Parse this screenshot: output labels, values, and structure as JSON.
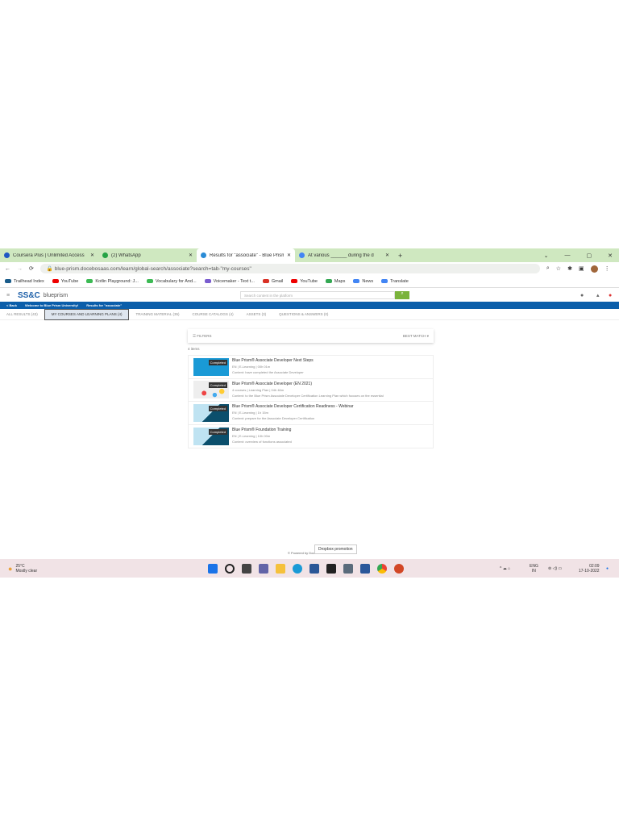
{
  "browser": {
    "tabs": [
      {
        "label": "Coursera Plus | Unlimited Access",
        "color": "#1f57c3"
      },
      {
        "label": "(2) WhatsApp",
        "color": "#25a244"
      },
      {
        "label": "Results for \"associate\" - Blue Prism",
        "color": "#2a8bd6",
        "active": true
      },
      {
        "label": "At various ______ during the d",
        "color": "#4285f4"
      }
    ],
    "new_tab": "+",
    "url": "blue-prism.docebosaas.com/learn/global-search/associate?search=tab-\"my-courses\"",
    "bookmarks": [
      {
        "label": "Trailhead Index",
        "color": "#1a5c8a"
      },
      {
        "label": "YouTube",
        "color": "#e00"
      },
      {
        "label": "Kotlin Playground: J...",
        "color": "#3cba54"
      },
      {
        "label": "Vocabulary for And...",
        "color": "#3cba54"
      },
      {
        "label": "Voicemaker - Text t...",
        "color": "#7a5ccf"
      },
      {
        "label": "Gmail",
        "color": "#d93025"
      },
      {
        "label": "YouTube",
        "color": "#e00"
      },
      {
        "label": "Maps",
        "color": "#34a853"
      },
      {
        "label": "News",
        "color": "#4285f4"
      },
      {
        "label": "Translate",
        "color": "#4285f4"
      }
    ]
  },
  "app": {
    "logo": "SS&C",
    "brand": "blueprism",
    "search_placeholder": "Search content in the platform",
    "breadcrumb": [
      "< Back",
      "Welcome to Blue Prism University!",
      "Results for \"associate\""
    ],
    "tabs": [
      "ALL RESULTS (43)",
      "MY COURSES AND LEARNING PLANS (4)",
      "TRAINING MATERIAL (35)",
      "COURSE CATALOGS (4)",
      "ASSETS (3)",
      "QUESTIONS & ANSWERS (0)"
    ],
    "filters": "FILTERS",
    "sort": "BEST MATCH",
    "count": "4 items",
    "results": [
      {
        "title": "Blue Prism® Associate Developer Next Steps",
        "meta": "EN | E-Learning | 00h 01m",
        "content": "Content: have completed the Associate Developer",
        "badge": "Completed",
        "thumb": "#1a9ad6"
      },
      {
        "title": "Blue Prism® Associate Developer (EN 2021)",
        "meta": "4 courses | Learning Plan | 04h 46m",
        "content": "Content: to the Blue Prism Associate Developer Certification Learning Plan which focuses on the essential",
        "badge": "Completed",
        "thumb": "#eeeeee"
      },
      {
        "title": "Blue Prism® Associate Developer Certification Readiness - Webinar",
        "meta": "EN | E-Learning | 1h 15m",
        "content": "Content: prepare for the Associate Developer Certification",
        "badge": "Completed",
        "thumb": "#bfe3f2"
      },
      {
        "title": "Blue Prism® Foundation Training",
        "meta": "EN | E-Learning | 10h 00m",
        "content": "Content: overview of functions associated",
        "badge": "Completed",
        "thumb": "#bfe3f2"
      }
    ],
    "footer": "© Powered by Docebo"
  },
  "tooltip": "Dropbox promotion",
  "taskbar": {
    "temp": "25°C",
    "weather": "Mostly clear",
    "lang": "ENG",
    "region": "IN",
    "time": "02:09",
    "date": "17-10-2022"
  }
}
